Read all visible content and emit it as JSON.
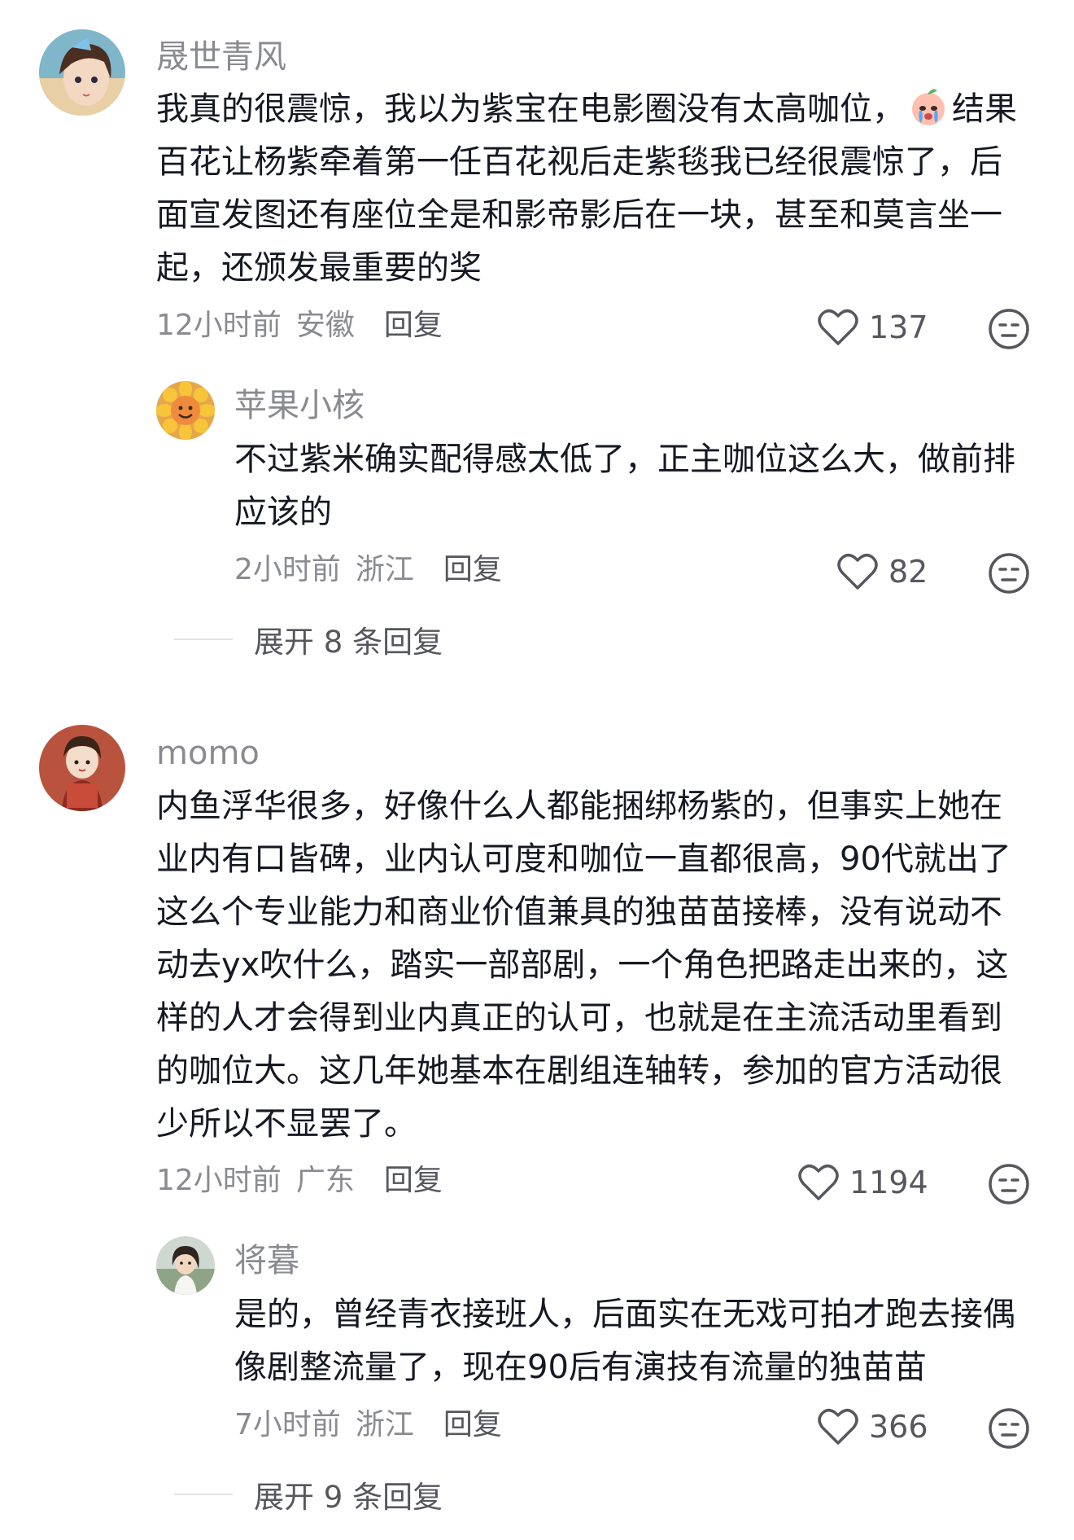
{
  "comments": [
    {
      "user": "晟世青风",
      "text_before_emoji": "我真的很震惊，我以为紫宝在电影圈没有太高咖位，",
      "text_after_emoji": "结果百花让杨紫牵着第一任百花视后走紫毯我已经很震惊了，后面宣发图还有座位全是和影帝影后在一块，甚至和莫言坐一起，还颁发最重要的奖",
      "time": "12小时前",
      "location": "安徽",
      "reply_label": "回复",
      "likes": "137",
      "replies": [
        {
          "user": "苹果小核",
          "text": "不过紫米确实配得感太低了，正主咖位这么大，做前排应该的",
          "time": "2小时前",
          "location": "浙江",
          "reply_label": "回复",
          "likes": "82"
        }
      ],
      "expand_label": "展开 8 条回复"
    },
    {
      "user": "momo",
      "text": "内鱼浮华很多，好像什么人都能捆绑杨紫的，但事实上她在业内有口皆碑，业内认可度和咖位一直都很高，90代就出了这么个专业能力和商业价值兼具的独苗苗接棒，没有说动不动去yx吹什么，踏实一部部剧，一个角色把路走出来的，这样的人才会得到业内真正的认可，也就是在主流活动里看到的咖位大。这几年她基本在剧组连轴转，参加的官方活动很少所以不显罢了。",
      "time": "12小时前",
      "location": "广东",
      "reply_label": "回复",
      "likes": "1194",
      "replies": [
        {
          "user": "将暮",
          "text": "是的，曾经青衣接班人，后面实在无戏可拍才跑去接偶像剧整流量了，现在90后有演技有流量的独苗苗",
          "time": "7小时前",
          "location": "浙江",
          "reply_label": "回复",
          "likes": "366"
        }
      ],
      "expand_label": "展开 9 条回复"
    }
  ]
}
